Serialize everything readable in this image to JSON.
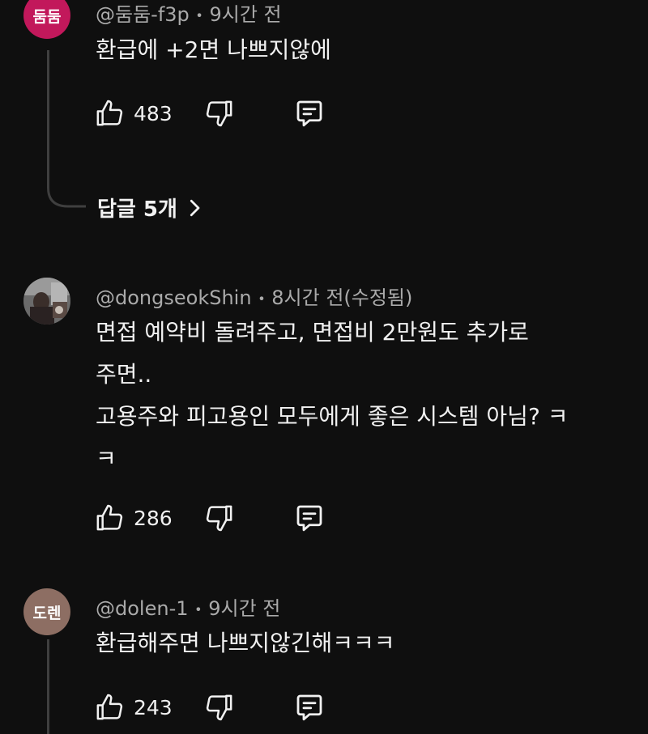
{
  "comments": [
    {
      "avatar_text": "둠둠",
      "avatar_color": "#c2185b",
      "author": "@둠둠-f3p",
      "time": "9시간 전",
      "lines": [
        "환급에 +2면 나쁘지않에"
      ],
      "likes": "483",
      "replies": "답글 5개"
    },
    {
      "author": "@dongseokShin",
      "time": "8시간 전(수정됨)",
      "lines": [
        "면접 예약비 돌려주고, 면접비 2만원도 추가로",
        "주면..",
        "고용주와 피고용인 모두에게 좋은 시스템 아님? ㅋ",
        "ㅋ"
      ],
      "likes": "286"
    },
    {
      "avatar_text": "도렌",
      "avatar_color": "#8d6e63",
      "author": "@dolen-1",
      "time": "9시간 전",
      "lines": [
        "환급해주면 나쁘지않긴해ㅋㅋㅋ"
      ],
      "likes": "243"
    }
  ],
  "meta_separator": "•"
}
